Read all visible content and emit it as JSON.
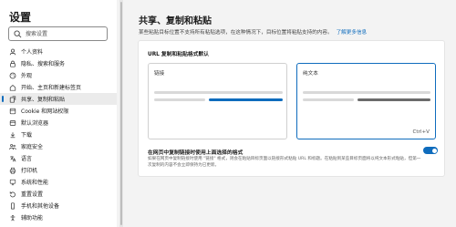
{
  "sidebar": {
    "title": "设置",
    "search": {
      "placeholder": "搜索设置"
    },
    "items": [
      {
        "label": "个人资料",
        "icon": "profile-icon"
      },
      {
        "label": "隐私、搜索和服务",
        "icon": "lock-icon"
      },
      {
        "label": "外观",
        "icon": "appearance-icon"
      },
      {
        "label": "开始、主页和新建标签页",
        "icon": "home-icon"
      },
      {
        "label": "共享、复制和粘贴",
        "icon": "share-icon",
        "selected": true
      },
      {
        "label": "Cookie 和网站权限",
        "icon": "cookie-icon"
      },
      {
        "label": "默认浏览器",
        "icon": "browser-icon"
      },
      {
        "label": "下载",
        "icon": "download-icon"
      },
      {
        "label": "家庭安全",
        "icon": "family-icon"
      },
      {
        "label": "语言",
        "icon": "language-icon"
      },
      {
        "label": "打印机",
        "icon": "printer-icon"
      },
      {
        "label": "系统和性能",
        "icon": "system-icon"
      },
      {
        "label": "重置设置",
        "icon": "reset-icon"
      },
      {
        "label": "手机和其他设备",
        "icon": "phone-icon"
      },
      {
        "label": "辅助功能",
        "icon": "accessibility-icon"
      }
    ]
  },
  "main": {
    "title": "共享、复制和粘贴",
    "description": "某些粘贴目标位置不支持所有粘贴选项，在这种情况下，目标位置将粘贴支持的内容。",
    "learn_more": "了解更多信息",
    "card": {
      "heading": "URL 复制和粘贴格式默认",
      "options": [
        {
          "label": "链接",
          "selected": false
        },
        {
          "label": "纯文本",
          "selected": true,
          "shortcut": "Ctrl+V"
        }
      ],
      "toggle": {
        "title": "在网页中复制链接时使用上面选择的格式",
        "description": "如果在网页中复制链接时使用 \"链接\" 格式，则会在粘贴目标页面以链接形式粘贴 URL 和标题。在粘贴到某些目标页面将以纯文本形式粘贴，但第一次复制的内容不会立即保持为已更新。",
        "enabled": true
      }
    }
  },
  "colors": {
    "accent": "#0f6cbd",
    "selected_bg": "#ebebeb",
    "page_bg": "#f3f3f3"
  }
}
